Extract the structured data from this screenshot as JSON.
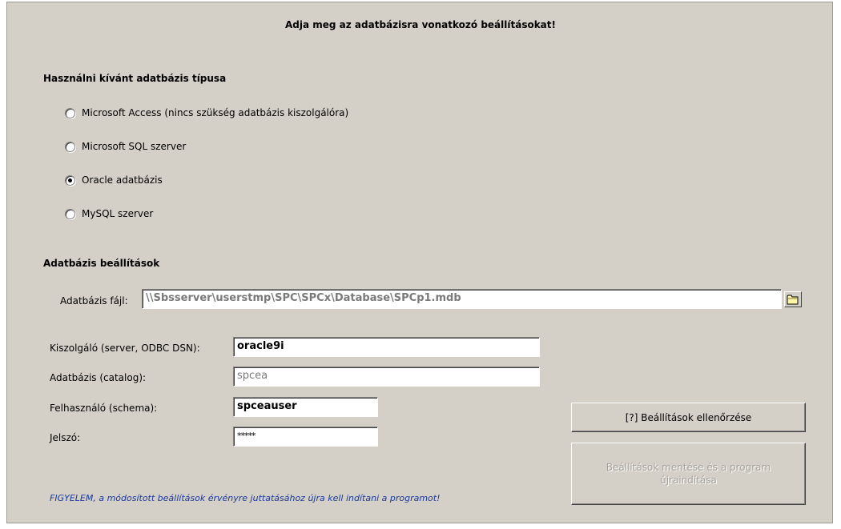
{
  "header": {
    "title": "Adja meg az adatbázisra vonatkozó beállításokat!"
  },
  "db_type": {
    "heading": "Használni kívánt adatbázis típusa",
    "options": [
      {
        "label": "Microsoft Access (nincs szükség adatbázis kiszolgálóra)",
        "checked": false
      },
      {
        "label": "Microsoft SQL szerver",
        "checked": false
      },
      {
        "label": "Oracle adatbázis",
        "checked": true
      },
      {
        "label": "MySQL szerver",
        "checked": false
      }
    ]
  },
  "settings": {
    "heading": "Adatbázis beállítások",
    "file_label": "Adatbázis fájl:",
    "file_value": "\\\\Sbsserver\\userstmp\\SPC\\SPCx\\Database\\SPCp1.mdb",
    "server_label": "Kiszolgáló (server, ODBC DSN):",
    "server_value": "oracle9i",
    "catalog_label": "Adatbázis (catalog):",
    "catalog_value": "spcea",
    "user_label": "Felhasználó (schema):",
    "user_value": "spceauser",
    "password_label": "Jelszó:",
    "password_value": "*****"
  },
  "buttons": {
    "check": "[?]   Beállítások ellenőrzése",
    "save_line1": "Beállítások mentése és a program",
    "save_line2": "újraindítása"
  },
  "warning": "FIGYELEM, a módosított beállítások érvényre juttatásához újra kell indítani a programot!",
  "icons": {
    "browse": "folder-icon"
  }
}
